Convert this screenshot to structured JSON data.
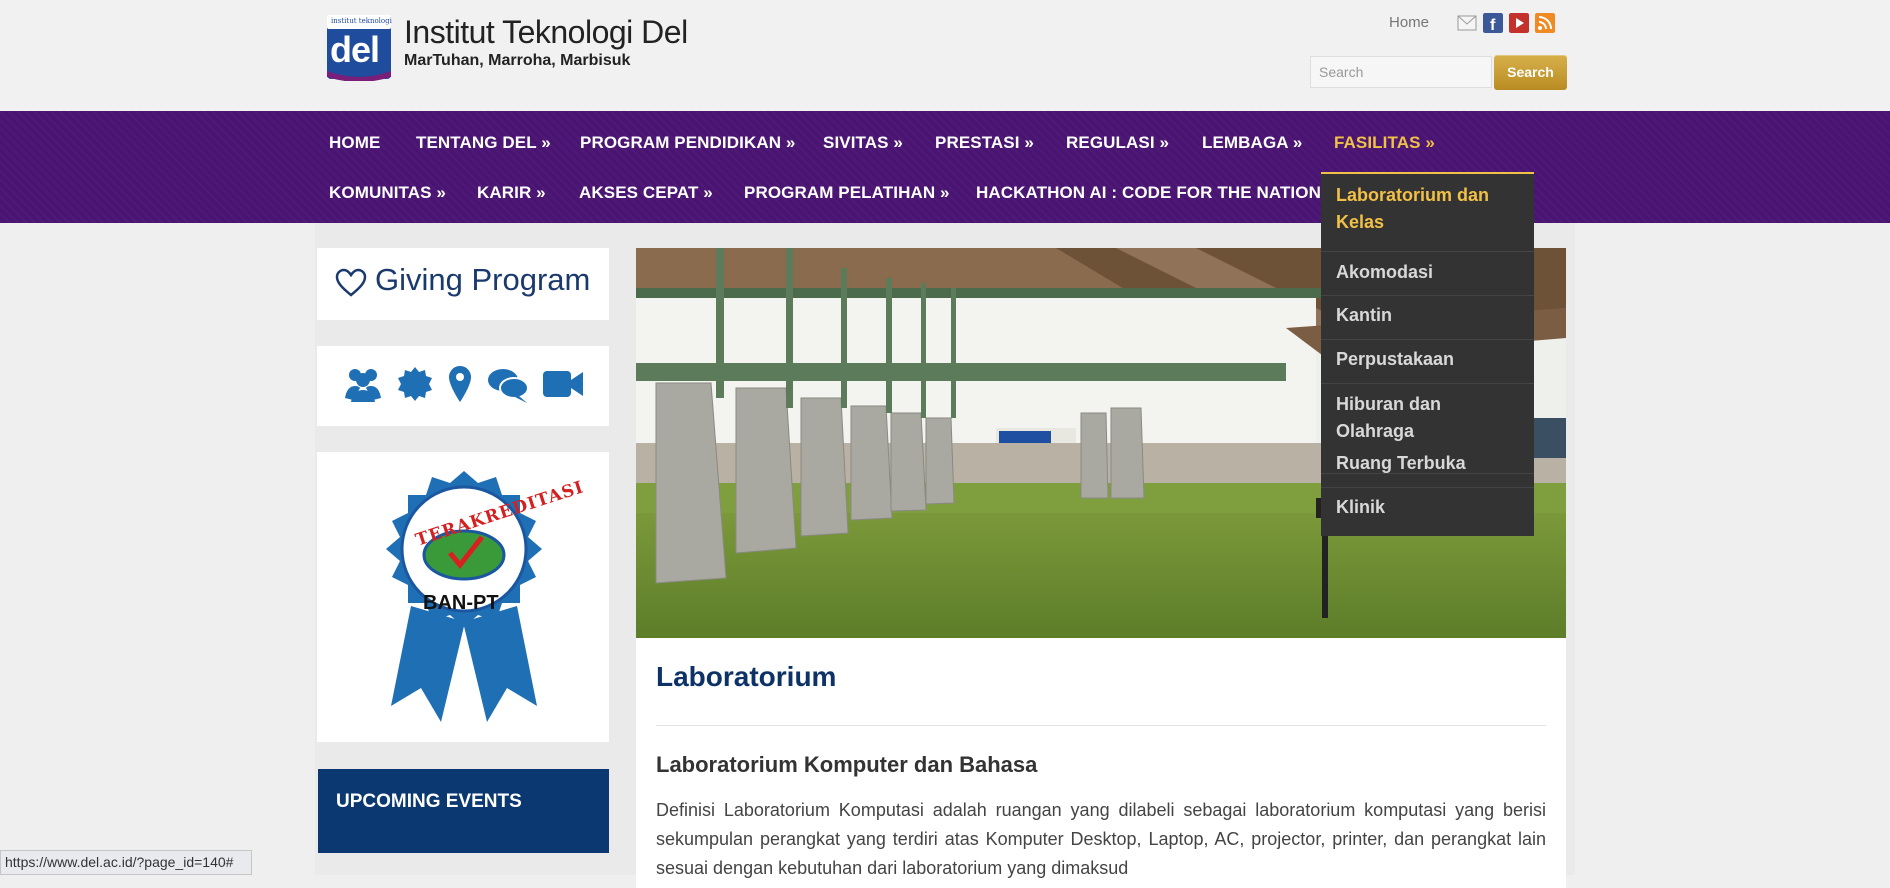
{
  "header": {
    "site_title": "Institut Teknologi Del",
    "tagline": "MarTuhan, Marroha, Marbisuk",
    "logo_text": "del",
    "logo_small_text": "institut teknologi",
    "home_link": "Home",
    "search_placeholder": "Search",
    "search_button": "Search",
    "social_icons": [
      "mail-icon",
      "facebook-icon",
      "youtube-icon",
      "rss-icon"
    ]
  },
  "nav": {
    "row1": [
      "HOME",
      "TENTANG DEL »",
      "PROGRAM PENDIDIKAN »",
      "SIVITAS »",
      "PRESTASI »",
      "REGULASI »",
      "LEMBAGA »",
      "FASILITAS »"
    ],
    "row2": [
      "KOMUNITAS »",
      "KARIR »",
      "AKSES CEPAT »",
      "PROGRAM PELATIHAN »",
      "HACKATHON AI : CODE FOR THE NATION »"
    ]
  },
  "dropdown": {
    "items": [
      "Laboratorium dan Kelas",
      "Akomodasi",
      "Kantin",
      "Perpustakaan",
      "Hiburan dan Olahraga",
      "Ruang Terbuka",
      "Klinik"
    ]
  },
  "sidebar": {
    "giving_program": "Giving Program",
    "quick_icons": [
      "users-icon",
      "badge-icon",
      "map-pin-icon",
      "chat-icon",
      "video-icon"
    ],
    "badge_text_top": "TERAKREDITASI",
    "badge_text_bottom": "BAN-PT",
    "upcoming_events": "UPCOMING EVENTS"
  },
  "main": {
    "page_title": "Laboratorium",
    "section_title": "Laboratorium Komputer dan Bahasa",
    "paragraph": "Definisi Laboratorium Komputasi adalah ruangan yang dilabeli sebagai laboratorium komputasi yang berisi sekumpulan perangkat yang terdiri atas Komputer Desktop, Laptop, AC, projector, printer, dan perangkat lain sesuai dengan kebutuhan dari laboratorium yang dimaksud"
  },
  "status_bar": {
    "url": "https://www.del.ac.id/?page_id=140#"
  },
  "colors": {
    "nav_bg": "#4a1572",
    "active": "#f1c046",
    "title_blue": "#0d3266",
    "events_bg": "#0b3870",
    "dropdown_bg": "#333333"
  }
}
